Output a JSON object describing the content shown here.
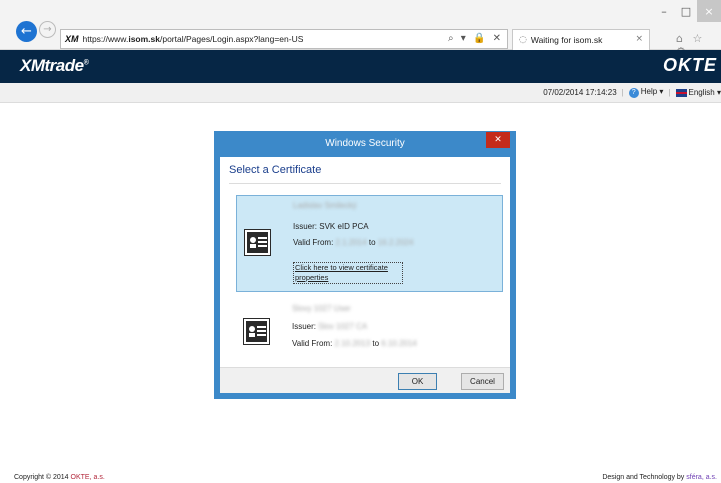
{
  "browser": {
    "address_logo": "XM",
    "url_prefix": "https://www.",
    "url_host": "isom.sk",
    "url_path": "/portal/Pages/Login.aspx?lang=en-US",
    "url_tools": "⌕ ▾ 🔒 ✕",
    "tab_title": "Waiting for isom.sk",
    "tab_close": "×",
    "minimize": "–",
    "maximize": "□",
    "close": "×",
    "toolbar_icons": "⌂ ☆ ⚙"
  },
  "site": {
    "logo_left": "XMtrade",
    "logo_reg": "®",
    "logo_right": "OKTE"
  },
  "infobar": {
    "datetime": "07/02/2014 17:14:23",
    "help_label": "Help",
    "help_arrow": "▾",
    "separator": "|",
    "language": "English",
    "language_arrow": "▾"
  },
  "dialog": {
    "title": "Windows Security",
    "close": "✕",
    "heading": "Select a Certificate",
    "certificates": [
      {
        "name": "Ladislav Smilecký",
        "issuer_label": "Issuer:",
        "issuer": "SVK eID PCA",
        "valid_label": "Valid From:",
        "valid_from": "2.1.2014",
        "valid_to_label": "to",
        "valid_to": "16.2.2024",
        "link": "Click here to view certificate properties"
      },
      {
        "name": "Slovy 1027 User",
        "issuer_label": "Issuer:",
        "issuer": "Slov 1027 CA",
        "valid_label": "Valid From:",
        "valid_from": "2.10.2013",
        "valid_to_label": "to",
        "valid_to": "6.10.2014"
      }
    ],
    "ok": "OK",
    "cancel": "Cancel"
  },
  "footer": {
    "copyright_prefix": "Copyright © 2014",
    "copyright_company": "OKTE, a.s.",
    "design_prefix": "Design and Technology by",
    "design_company": "sféra, a.s."
  }
}
